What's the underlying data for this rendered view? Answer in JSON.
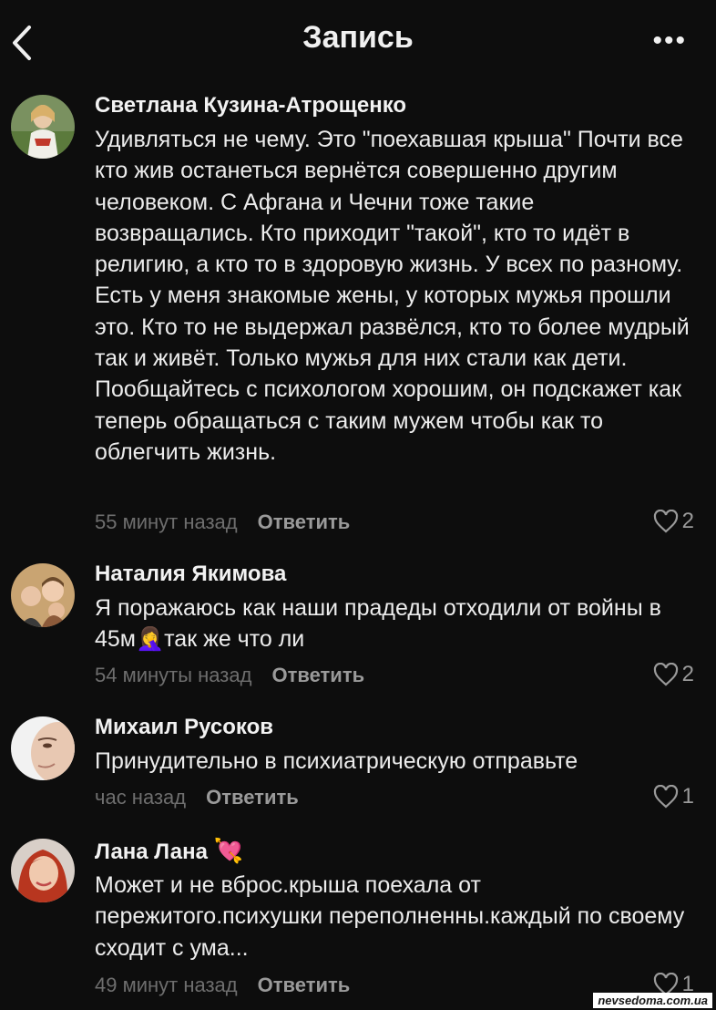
{
  "header": {
    "title": "Запись",
    "more_glyph": "•••"
  },
  "comments": [
    {
      "name": "Светлана Кузина-Атрощенко",
      "text": "Удивляться не чему. Это \"поехавшая крыша\" Почти все кто жив останеться вернётся совершенно другим человеком. С Афгана и Чечни тоже такие возвращались. Кто приходит \"такой\", кто то идёт в религию, а кто то в здоровую жизнь. У всех по разному. Есть у меня знакомые жены, у которых мужья прошли это. Кто то не выдержал развёлся, кто то более мудрый так и живёт. Только мужья для них стали как дети. Пообщайтесь с психологом хорошим, он подскажет как теперь обращаться с таким мужем чтобы как то облегчить жизнь.",
      "time": "55 минут назад",
      "reply": "Ответить",
      "likes": "2"
    },
    {
      "name": "Наталия Якимова",
      "text_before": "Я поражаюсь как наши прадеды отходили от войны в 45м",
      "emoji": "🤦‍♀️",
      "text_after": "так же что ли",
      "time": "54 минуты назад",
      "reply": "Ответить",
      "likes": "2"
    },
    {
      "name": "Михаил Русоков",
      "text": "Принудительно в психиатрическую отправьте",
      "time": "час назад",
      "reply": "Ответить",
      "likes": "1"
    },
    {
      "name": "Лана Лана",
      "name_emoji": "💘",
      "text": "Может и не вброс.крыша поехала от пережитого.психушки переполненны.каждый по своему сходит с ума...",
      "time": "49 минут назад",
      "reply": "Ответить",
      "likes": "1"
    }
  ],
  "watermark": "nevsedoma.com.ua",
  "colors": {
    "background": "#0d0d0d",
    "text": "#ececec",
    "muted": "#6e6e6e",
    "action": "#9a9a9a"
  }
}
